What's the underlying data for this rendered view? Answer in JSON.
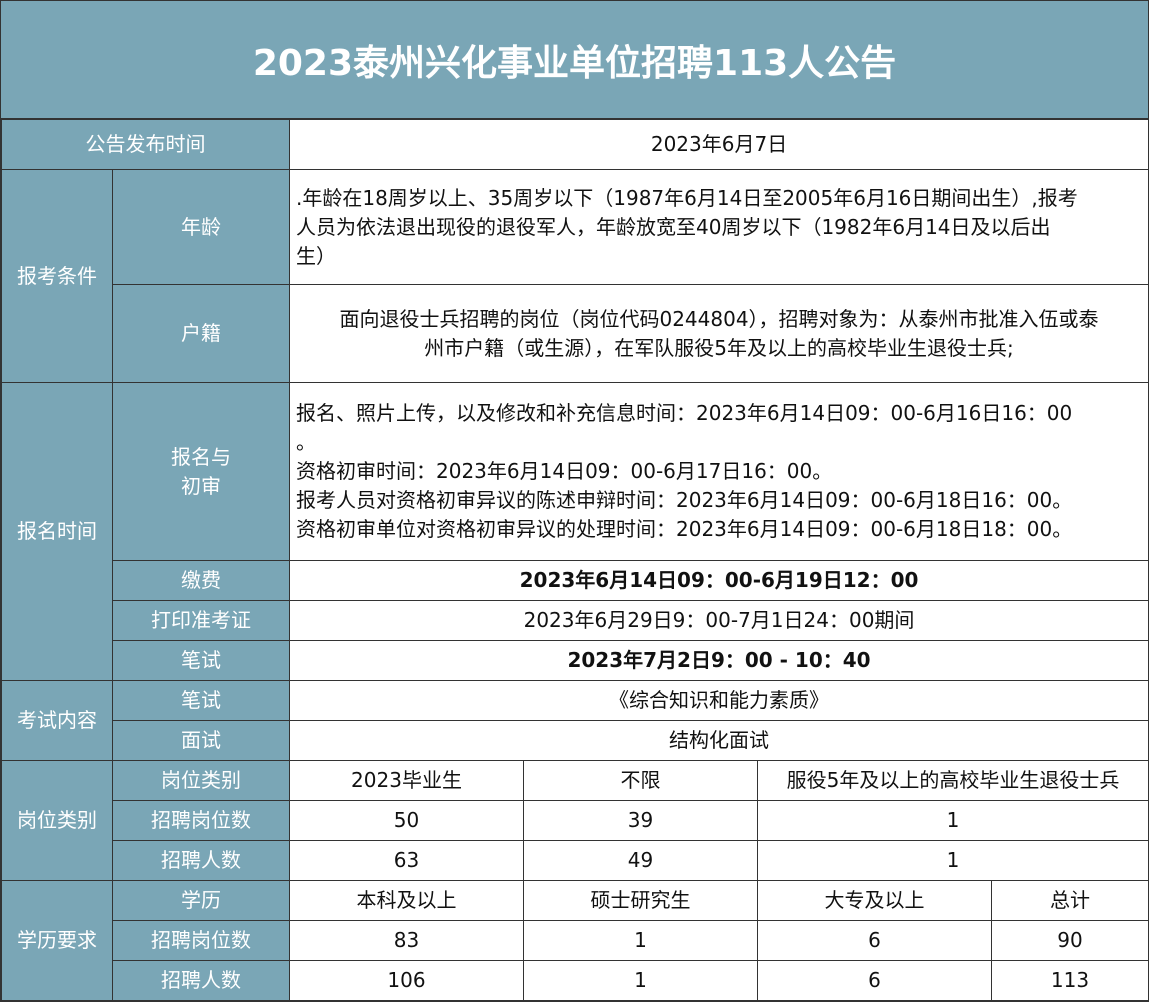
{
  "title": "2023泰州兴化事业单位招聘113人公告",
  "colors": {
    "header_bg": "#7aa6b6",
    "header_text": "#ffffff",
    "border": "#333333"
  },
  "publish": {
    "label": "公告发布时间",
    "value": "2023年6月7日"
  },
  "conditions": {
    "label": "报考条件",
    "age": {
      "label": "年龄",
      "lines": [
        ".年龄在18周岁以上、35周岁以下（1987年6月14日至2005年6月16日期间出生）,报考",
        "人员为依法退出现役的退役军人，年龄放宽至40周岁以下（1982年6月14日及以后出",
        "生）"
      ]
    },
    "household": {
      "label": "户籍",
      "lines": [
        "面向退役士兵招聘的岗位（岗位代码0244804），招聘对象为：从泰州市批准入伍或泰",
        "州市户籍（或生源），在军队服役5年及以上的高校毕业生退役士兵;"
      ]
    }
  },
  "schedule": {
    "label": "报名时间",
    "registration": {
      "label_line1": "报名与",
      "label_line2": "初审",
      "lines": [
        "报名、照片上传，以及修改和补充信息时间：2023年6月14日09：00-6月16日16：00",
        "。",
        "资格初审时间：2023年6月14日09：00-6月17日16：00。",
        "报考人员对资格初审异议的陈述申辩时间：2023年6月14日09：00-6月18日16：00。",
        "资格初审单位对资格初审异议的处理时间：2023年6月14日09：00-6月18日18：00。"
      ]
    },
    "payment": {
      "label": "缴费",
      "value": "2023年6月14日09：00-6月19日12：00"
    },
    "print": {
      "label": "打印准考证",
      "value": "2023年6月29日9：00-7月1日24：00期间"
    },
    "written": {
      "label": "笔试",
      "value": "2023年7月2日9：00 - 10：40"
    }
  },
  "exam": {
    "label": "考试内容",
    "written": {
      "label": "笔试",
      "value": "《综合知识和能力素质》"
    },
    "interview": {
      "label": "面试",
      "value": "结构化面试"
    }
  },
  "positions": {
    "label": "岗位类别",
    "rows": [
      {
        "label": "岗位类别",
        "values": [
          "2023毕业生",
          "不限",
          "服役5年及以上的高校毕业生退役士兵"
        ]
      },
      {
        "label": "招聘岗位数",
        "values": [
          "50",
          "39",
          "1"
        ]
      },
      {
        "label": "招聘人数",
        "values": [
          "63",
          "49",
          "1"
        ]
      }
    ]
  },
  "education": {
    "label": "学历要求",
    "rows": [
      {
        "label": "学历",
        "values": [
          "本科及以上",
          "硕士研究生",
          "大专及以上",
          "总计"
        ]
      },
      {
        "label": "招聘岗位数",
        "values": [
          "83",
          "1",
          "6",
          "90"
        ]
      },
      {
        "label": "招聘人数",
        "values": [
          "106",
          "1",
          "6",
          "113"
        ]
      }
    ]
  }
}
